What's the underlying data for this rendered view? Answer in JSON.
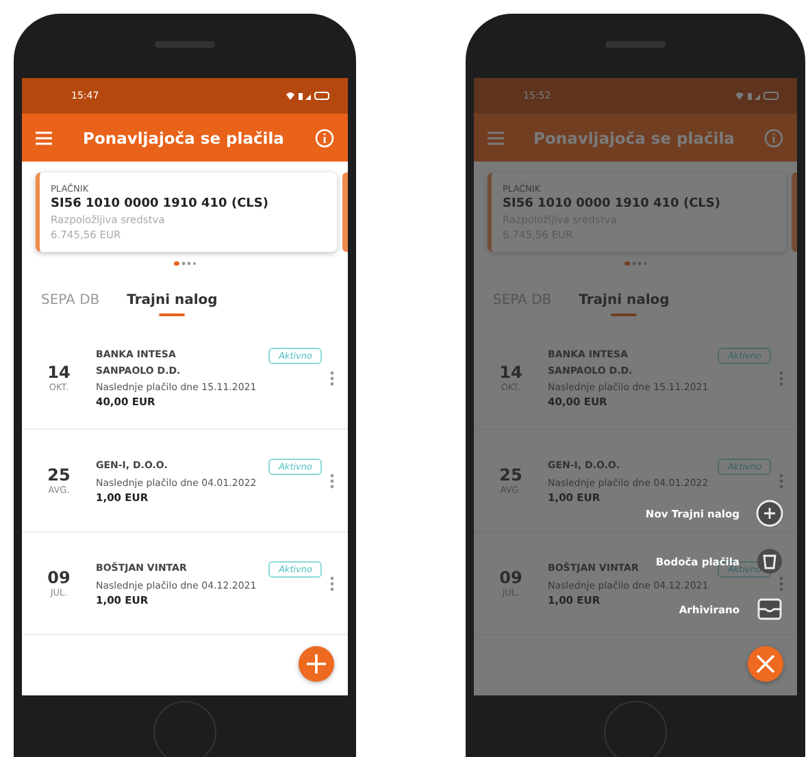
{
  "phones": [
    {
      "status_time": "15:47",
      "title": "Ponavljajoča se plačila",
      "dimmed": false,
      "payer": {
        "label": "PLAČNIK",
        "account": "SI56 1010 0000 1910 410 (CLS)",
        "balance_label": "Razpoložljiva sredstva",
        "balance": "6.745,56 EUR"
      },
      "tabs": [
        {
          "label": "SEPA DB",
          "selected": false
        },
        {
          "label": "Trajni nalog",
          "selected": true
        }
      ],
      "payments": [
        {
          "day": "14",
          "month": "OKT.",
          "payee": "BANKA INTESA SANPAOLO D.D.",
          "status": "Aktivno",
          "next": "Naslednje plačilo dne 15.11.2021",
          "amount": "40,00 EUR"
        },
        {
          "day": "25",
          "month": "AVG.",
          "payee": "GEN-I, D.O.O.",
          "status": "Aktivno",
          "next": "Naslednje plačilo dne 04.01.2022",
          "amount": "1,00 EUR"
        },
        {
          "day": "09",
          "month": "JUL.",
          "payee": "BOŠTJAN VINTAR",
          "status": "Aktivno",
          "next": "Naslednje plačilo dne 04.12.2021",
          "amount": "1,00 EUR"
        }
      ],
      "fab_open": false
    },
    {
      "status_time": "15:52",
      "title": "Ponavljajoča se plačila",
      "dimmed": true,
      "payer": {
        "label": "PLAČNIK",
        "account": "SI56 1010 0000 1910 410 (CLS)",
        "balance_label": "Razpoložljiva sredstva",
        "balance": "6.745,56 EUR"
      },
      "tabs": [
        {
          "label": "SEPA DB",
          "selected": false
        },
        {
          "label": "Trajni nalog",
          "selected": true
        }
      ],
      "payments": [
        {
          "day": "14",
          "month": "OKT.",
          "payee": "BANKA INTESA SANPAOLO D.D.",
          "status": "Aktivno",
          "next": "Naslednje plačilo dne 15.11.2021",
          "amount": "40,00 EUR"
        },
        {
          "day": "25",
          "month": "AVG.",
          "payee": "GEN-I, D.O.O.",
          "status": "Aktivno",
          "next": "Naslednje plačilo dne 04.01.2022",
          "amount": "1,00 EUR"
        },
        {
          "day": "09",
          "month": "JUL.",
          "payee": "BOŠTJAN VINTAR",
          "status": "Aktivno",
          "next": "Naslednje plačilo dne 04.12.2021",
          "amount": "1,00 EUR"
        }
      ],
      "fab_open": true,
      "menu": [
        {
          "label": "Nov Trajni nalog",
          "kind": "plus"
        },
        {
          "label": "Bodoča plačila",
          "kind": "bucket"
        },
        {
          "label": "Arhivirano",
          "kind": "tray"
        }
      ]
    }
  ]
}
